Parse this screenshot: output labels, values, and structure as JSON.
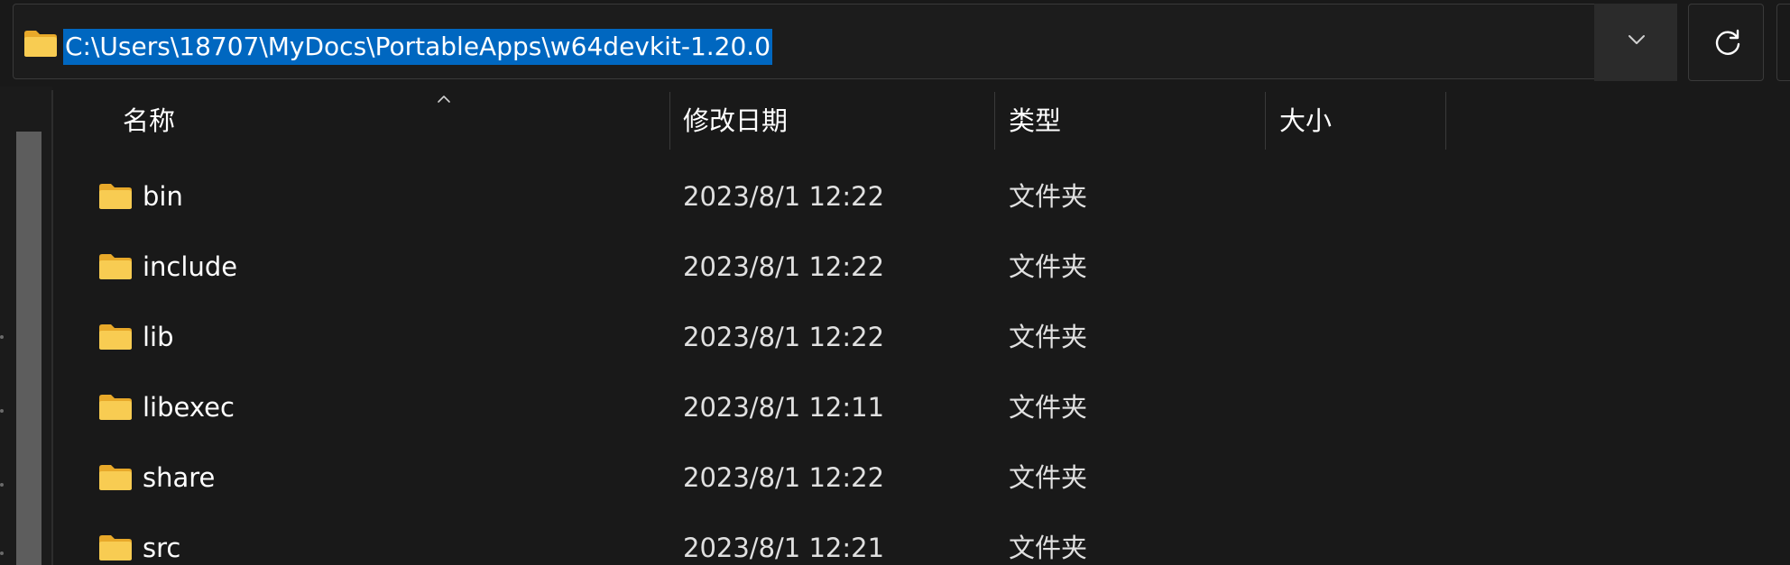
{
  "address_bar": {
    "path": "C:\\Users\\18707\\MyDocs\\PortableApps\\w64devkit-1.20.0",
    "folder_icon": "folder-icon",
    "dropdown_icon": "chevron-down-icon",
    "refresh_icon": "refresh-icon",
    "selection_color": "#0067c0"
  },
  "columns": [
    {
      "label": "名称",
      "sorted": true
    },
    {
      "label": "修改日期"
    },
    {
      "label": "类型"
    },
    {
      "label": "大小"
    }
  ],
  "rows": [
    {
      "name": "bin",
      "modified": "2023/8/1 12:22",
      "type": "文件夹",
      "size": ""
    },
    {
      "name": "include",
      "modified": "2023/8/1 12:22",
      "type": "文件夹",
      "size": ""
    },
    {
      "name": "lib",
      "modified": "2023/8/1 12:22",
      "type": "文件夹",
      "size": ""
    },
    {
      "name": "libexec",
      "modified": "2023/8/1 12:11",
      "type": "文件夹",
      "size": ""
    },
    {
      "name": "share",
      "modified": "2023/8/1 12:22",
      "type": "文件夹",
      "size": ""
    },
    {
      "name": "src",
      "modified": "2023/8/1 12:21",
      "type": "文件夹",
      "size": ""
    }
  ],
  "colors": {
    "background": "#191919",
    "folder_yellow": "#f5c542",
    "text": "#ffffff",
    "muted_text": "#e0e0e0"
  }
}
